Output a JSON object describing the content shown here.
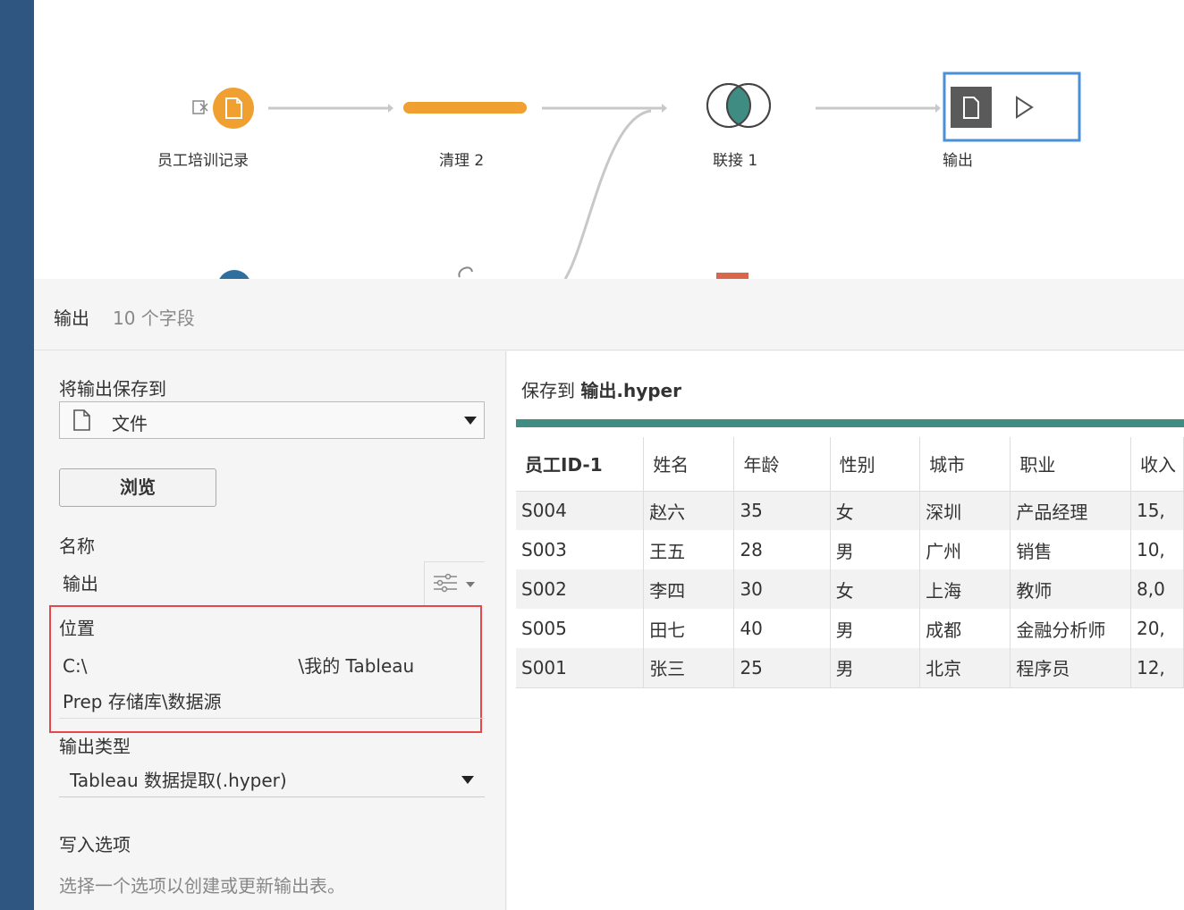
{
  "flow": {
    "nodes": [
      {
        "label": "员工培训记录",
        "icon": "file-icon"
      },
      {
        "label": "清理 2",
        "icon": "clean-bar"
      },
      {
        "label": "联接 1",
        "icon": "join-icon"
      },
      {
        "label": "输出",
        "icon": "output-icon"
      }
    ]
  },
  "panel": {
    "title": "输出",
    "field_count": "10 个字段"
  },
  "settings": {
    "save_to_label": "将输出保存到",
    "save_to_value": "文件",
    "browse_label": "浏览",
    "name_label": "名称",
    "name_value": "输出",
    "location_label": "位置",
    "location_start": "C:\\",
    "location_end": "\\我的 Tableau",
    "location_line2": "Prep 存储库\\数据源",
    "output_type_label": "输出类型",
    "output_type_value": "Tableau 数据提取(.hyper)",
    "write_options_label": "写入选项",
    "write_options_hint": "选择一个选项以创建或更新输出表。"
  },
  "preview": {
    "title_prefix": "保存到",
    "title_file": "输出.hyper",
    "columns": [
      "员工ID-1",
      "姓名",
      "年龄",
      "性别",
      "城市",
      "职业",
      "收入"
    ],
    "rows": [
      [
        "S004",
        "赵六",
        "35",
        "女",
        "深圳",
        "产品经理",
        "15,"
      ],
      [
        "S003",
        "王五",
        "28",
        "男",
        "广州",
        "销售",
        "10,"
      ],
      [
        "S002",
        "李四",
        "30",
        "女",
        "上海",
        "教师",
        "8,0"
      ],
      [
        "S005",
        "田七",
        "40",
        "男",
        "成都",
        "金融分析师",
        "20,"
      ],
      [
        "S001",
        "张三",
        "25",
        "男",
        "北京",
        "程序员",
        "12,"
      ]
    ]
  },
  "colors": {
    "accent_orange": "#f0a030",
    "join_teal": "#3f8c83",
    "selection_blue": "#4a90d9",
    "highlight_red": "#e8474a",
    "sidebar_blue": "#2f5680"
  }
}
